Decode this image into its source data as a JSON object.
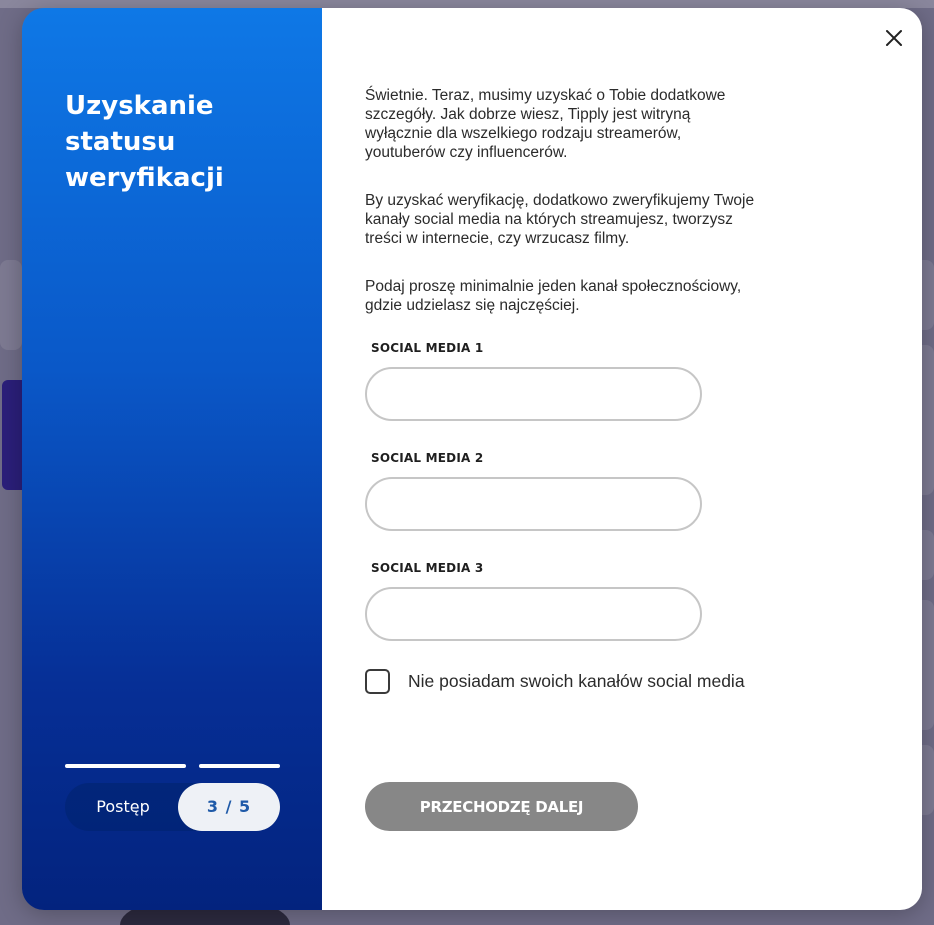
{
  "sidebar": {
    "title": "Uzyskanie statusu weryfikacji",
    "progress_label": "Postęp",
    "progress_value": "3 / 5",
    "step_current": 3,
    "step_total": 5
  },
  "form": {
    "intro_paragraphs": [
      "Świetnie. Teraz, musimy uzyskać o Tobie dodatkowe szczegóły. Jak dobrze wiesz, Tipply jest witryną wyłącznie dla wszelkiego rodzaju streamerów, youtuberów czy influencerów.",
      "By uzyskać weryfikację, dodatkowo zweryfikujemy Twoje kanały social media na których streamujesz, tworzysz treści w internecie, czy wrzucasz filmy.",
      "Podaj proszę minimalnie jeden kanał społecznościowy, gdzie udzielasz się najczęściej."
    ],
    "fields": [
      {
        "label": "SOCIAL MEDIA 1",
        "value": ""
      },
      {
        "label": "SOCIAL MEDIA 2",
        "value": ""
      },
      {
        "label": "SOCIAL MEDIA 3",
        "value": ""
      }
    ],
    "no_social_checkbox_label": "Nie posiadam swoich kanałów social media",
    "no_social_checked": false,
    "submit_label": "PRZECHODZĘ DALEJ"
  },
  "colors": {
    "sidebar_gradient_top": "#0e78e6",
    "sidebar_gradient_bottom": "#03237e",
    "button_disabled": "#878787",
    "progress_count_text": "#1f5aa8"
  },
  "icons": {
    "close": "close-icon"
  }
}
